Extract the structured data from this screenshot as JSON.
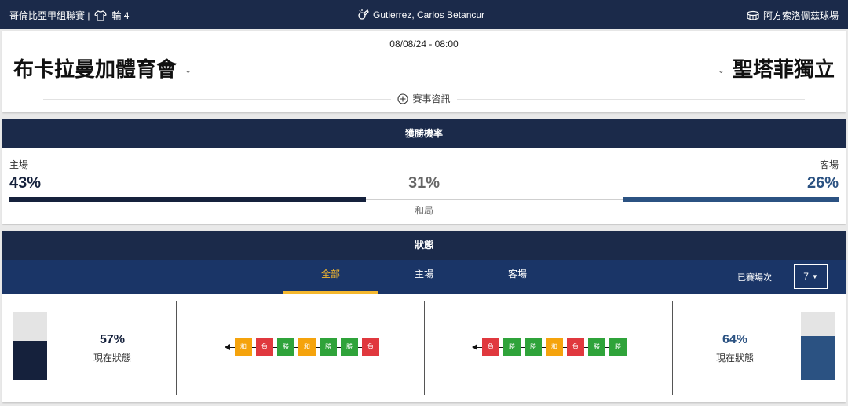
{
  "topbar": {
    "league": "哥倫比亞甲組聯賽 |",
    "round": "輪 4",
    "round_icon": "jersey-icon",
    "referee": "Gutierrez, Carlos Betancur",
    "referee_icon": "whistle-icon",
    "venue": "阿方索洛佩茲球場",
    "venue_icon": "stadium-icon"
  },
  "match": {
    "datetime": "08/08/24 - 08:00",
    "home_team": "布卡拉曼加體育會",
    "away_team": "聖塔菲獨立",
    "info_label": "賽事咨訊",
    "info_icon": "plus-circle-icon"
  },
  "win_probability": {
    "title": "獲勝機率",
    "home_label": "主場",
    "home_pct": "43%",
    "draw_pct": "31%",
    "draw_label": "和局",
    "away_label": "客場",
    "away_pct": "26%",
    "home_value": 43,
    "draw_value": 31,
    "away_value": 26
  },
  "form": {
    "title": "狀態",
    "tabs": [
      {
        "label": "全部",
        "active": true
      },
      {
        "label": "主場",
        "active": false
      },
      {
        "label": "客場",
        "active": false
      }
    ],
    "matches_played_label": "已賽場次",
    "matches_played_value": "7",
    "home": {
      "pct": "57%",
      "value": 57,
      "caption": "現在狀態",
      "results": [
        "和",
        "負",
        "勝",
        "和",
        "勝",
        "勝",
        "負"
      ]
    },
    "away": {
      "pct": "64%",
      "value": 64,
      "caption": "現在狀態",
      "results": [
        "負",
        "勝",
        "勝",
        "和",
        "負",
        "勝",
        "勝"
      ]
    }
  },
  "colors": {
    "navy": "#1b2a4a",
    "tabs_bg": "#1a3567",
    "home_bar": "#15213c",
    "away_bar": "#2b5282",
    "draw_bar": "#cfcfcf",
    "active_tab": "#f5b82e",
    "win": "#2fa33a",
    "loss": "#e0383e",
    "draw": "#f5a30c"
  }
}
